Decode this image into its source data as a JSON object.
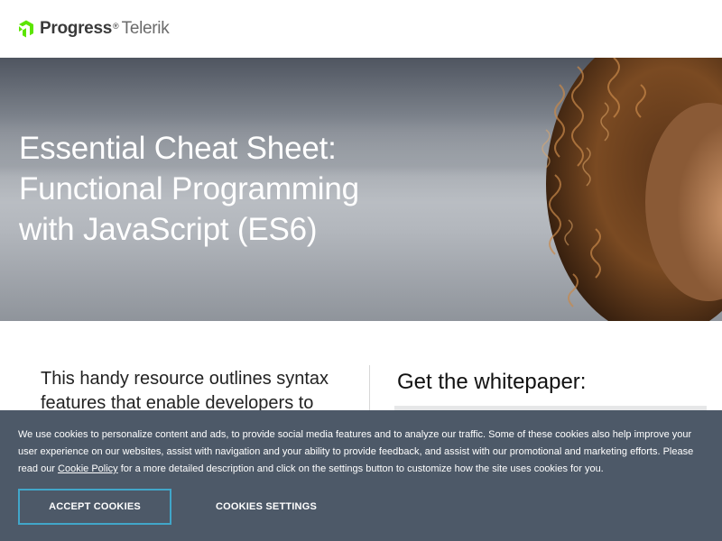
{
  "header": {
    "logo_brand": "Progress",
    "logo_product": "Telerik",
    "logo_mark": "®",
    "accent": "#5ce500"
  },
  "hero": {
    "title": "Essential Cheat Sheet: Functional Programming with JavaScript (ES6)"
  },
  "content": {
    "intro": "This handy resource outlines syntax features that enable developers to",
    "whitepaper_heading": "Get the whitepaper:"
  },
  "cookie_banner": {
    "text_before_link": "We use cookies to personalize content and ads, to provide social media features and to analyze our traffic. Some of these cookies also help improve your user experience on our websites, assist with navigation and your ability to provide feedback, and assist with our promotional and marketing efforts. Please read our ",
    "link_text": "Cookie Policy",
    "text_after_link": " for a more detailed description and click on the settings button to customize how the site uses cookies for you.",
    "accept_label": "ACCEPT COOKIES",
    "settings_label": "COOKIES SETTINGS",
    "background": "#4d5968",
    "accept_border": "#41a6c9"
  }
}
